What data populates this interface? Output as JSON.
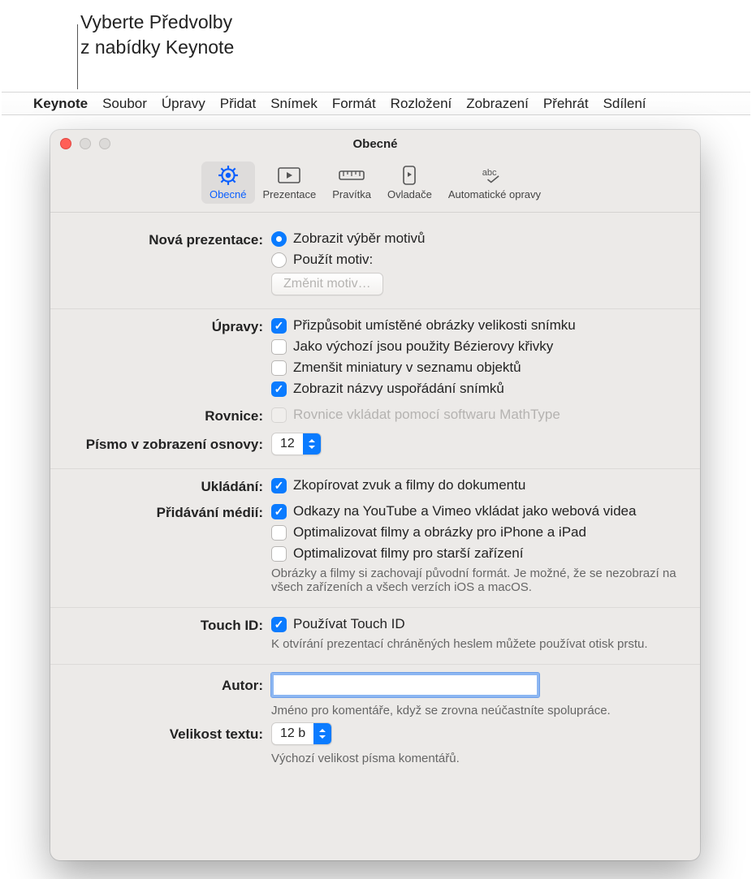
{
  "callout": "Vyberte Předvolby\nz nabídky Keynote",
  "callout_line1": "Vyberte Předvolby",
  "callout_line2": "z nabídky Keynote",
  "menubar": [
    "Keynote",
    "Soubor",
    "Úpravy",
    "Přidat",
    "Snímek",
    "Formát",
    "Rozložení",
    "Zobrazení",
    "Přehrát",
    "Sdílení"
  ],
  "window": {
    "title": "Obecné",
    "tabs": [
      {
        "id": "general",
        "label": "Obecné",
        "selected": true
      },
      {
        "id": "presentation",
        "label": "Prezentace",
        "selected": false
      },
      {
        "id": "rulers",
        "label": "Pravítka",
        "selected": false
      },
      {
        "id": "remotes",
        "label": "Ovladače",
        "selected": false
      },
      {
        "id": "autocorrect",
        "label": "Automatické opravy",
        "selected": false
      }
    ]
  },
  "sections": {
    "new_presentation": {
      "label": "Nová prezentace:",
      "radio1": "Zobrazit výběr motivů",
      "radio2": "Použít motiv:",
      "radio_selected": "radio1",
      "button": "Změnit motiv…"
    },
    "editing": {
      "label": "Úpravy:",
      "items": [
        {
          "text": "Přizpůsobit umístěné obrázky velikosti snímku",
          "checked": true
        },
        {
          "text": "Jako výchozí jsou použity Bézierovy křivky",
          "checked": false
        },
        {
          "text": "Zmenšit miniatury v seznamu objektů",
          "checked": false
        },
        {
          "text": "Zobrazit názvy uspořádání snímků",
          "checked": true
        }
      ]
    },
    "equations": {
      "label": "Rovnice:",
      "text": "Rovnice vkládat pomocí softwaru MathType",
      "disabled": true
    },
    "outline_font": {
      "label": "Písmo v zobrazení osnovy:",
      "value": "12"
    },
    "saving": {
      "label": "Ukládání:",
      "text": "Zkopírovat zvuk a filmy do dokumentu",
      "checked": true
    },
    "adding_media": {
      "label": "Přidávání médií:",
      "items": [
        {
          "text": "Odkazy na YouTube a Vimeo vkládat jako webová videa",
          "checked": true
        },
        {
          "text": "Optimalizovat filmy a obrázky pro iPhone a iPad",
          "checked": false
        },
        {
          "text": "Optimalizovat filmy pro starší zařízení",
          "checked": false
        }
      ],
      "hint": "Obrázky a filmy si zachovají původní formát. Je možné, že se nezobrazí na všech zařízeních a všech verzích iOS a macOS."
    },
    "touchid": {
      "label": "Touch ID:",
      "text": "Používat Touch ID",
      "checked": true,
      "hint": "K otvírání prezentací chráněných heslem můžete používat otisk prstu."
    },
    "author": {
      "label": "Autor:",
      "value": "",
      "hint": "Jméno pro komentáře, když se zrovna neúčastníte spolupráce."
    },
    "text_size": {
      "label": "Velikost textu:",
      "value": "12 b",
      "hint": "Výchozí velikost písma komentářů."
    }
  }
}
